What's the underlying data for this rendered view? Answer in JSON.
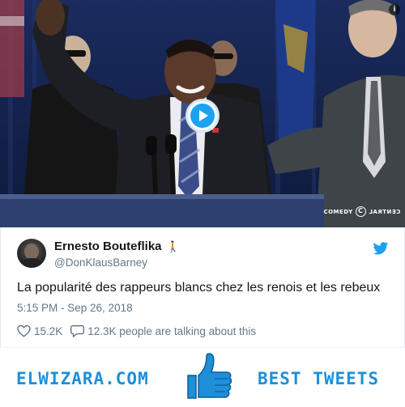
{
  "media": {
    "info_label": "i",
    "watermark_brand": "COMEDY",
    "watermark_mirrored": "CENTRAL",
    "play_icon": "play-icon"
  },
  "tweet": {
    "author_name": "Ernesto Bouteflika",
    "author_emoji": "🚶",
    "handle": "@DonKlausBarney",
    "text": "La popularité des rappeurs blancs chez les renois et les rebeux",
    "timestamp": "5:15 PM - Sep 26, 2018",
    "likes": "15.2K",
    "conversation": "12.3K people are talking about this",
    "twitter_icon": "twitter-bird-icon",
    "like_icon": "heart-icon",
    "reply_icon": "speech-bubble-icon"
  },
  "footer": {
    "site_name": "ELWIZARA.COM",
    "tagline": "BEST TWEETS",
    "thumb_icon": "thumbs-up-icon"
  },
  "colors": {
    "twitter_blue": "#1da1f2",
    "footer_blue": "#1e8fd8",
    "text_primary": "#14171a",
    "text_secondary": "#657786"
  }
}
